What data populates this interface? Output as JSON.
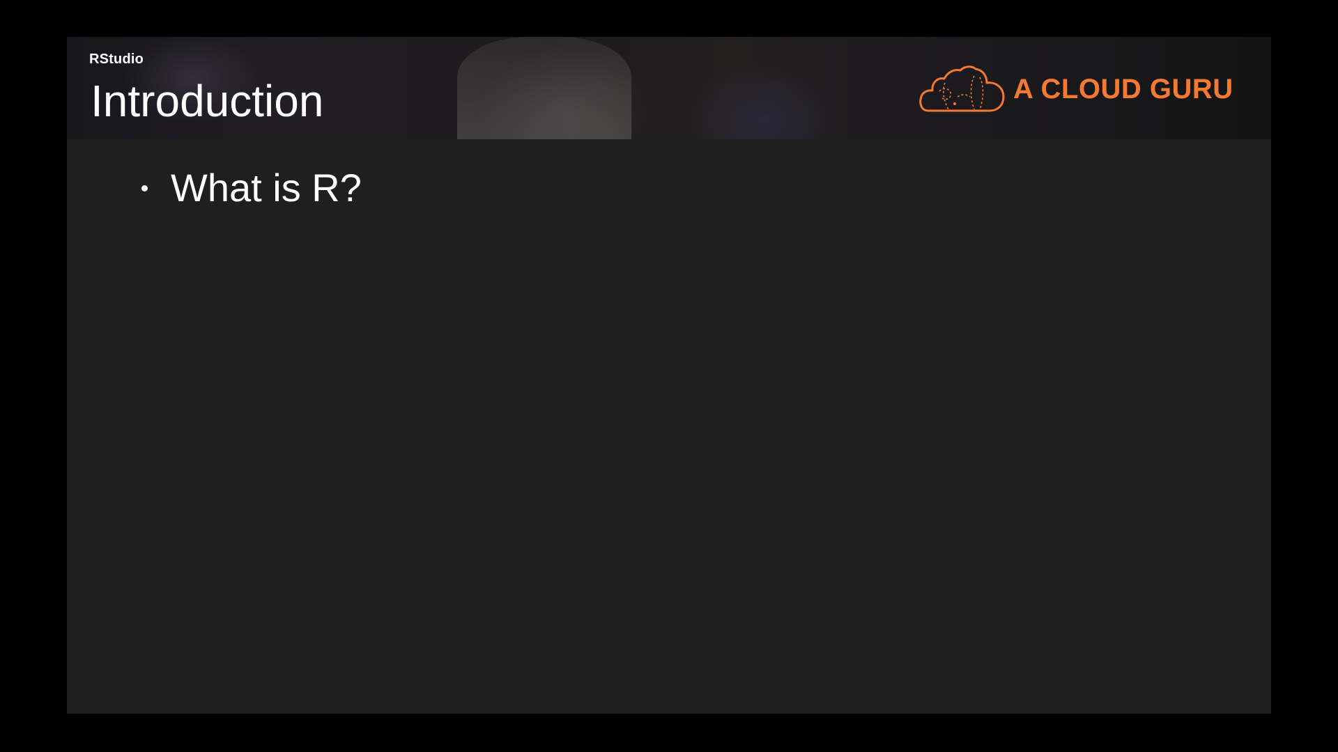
{
  "header": {
    "subtitle": "RStudio",
    "title": "Introduction"
  },
  "brand": {
    "name": "A CLOUD GURU",
    "accent_color": "#f47a33",
    "icon": "cloud-logo-icon"
  },
  "content": {
    "bullets": [
      {
        "text": "What is R?"
      }
    ]
  },
  "colors": {
    "background": "#000000",
    "slide": "#1f1f1f",
    "text": "#ffffff"
  }
}
